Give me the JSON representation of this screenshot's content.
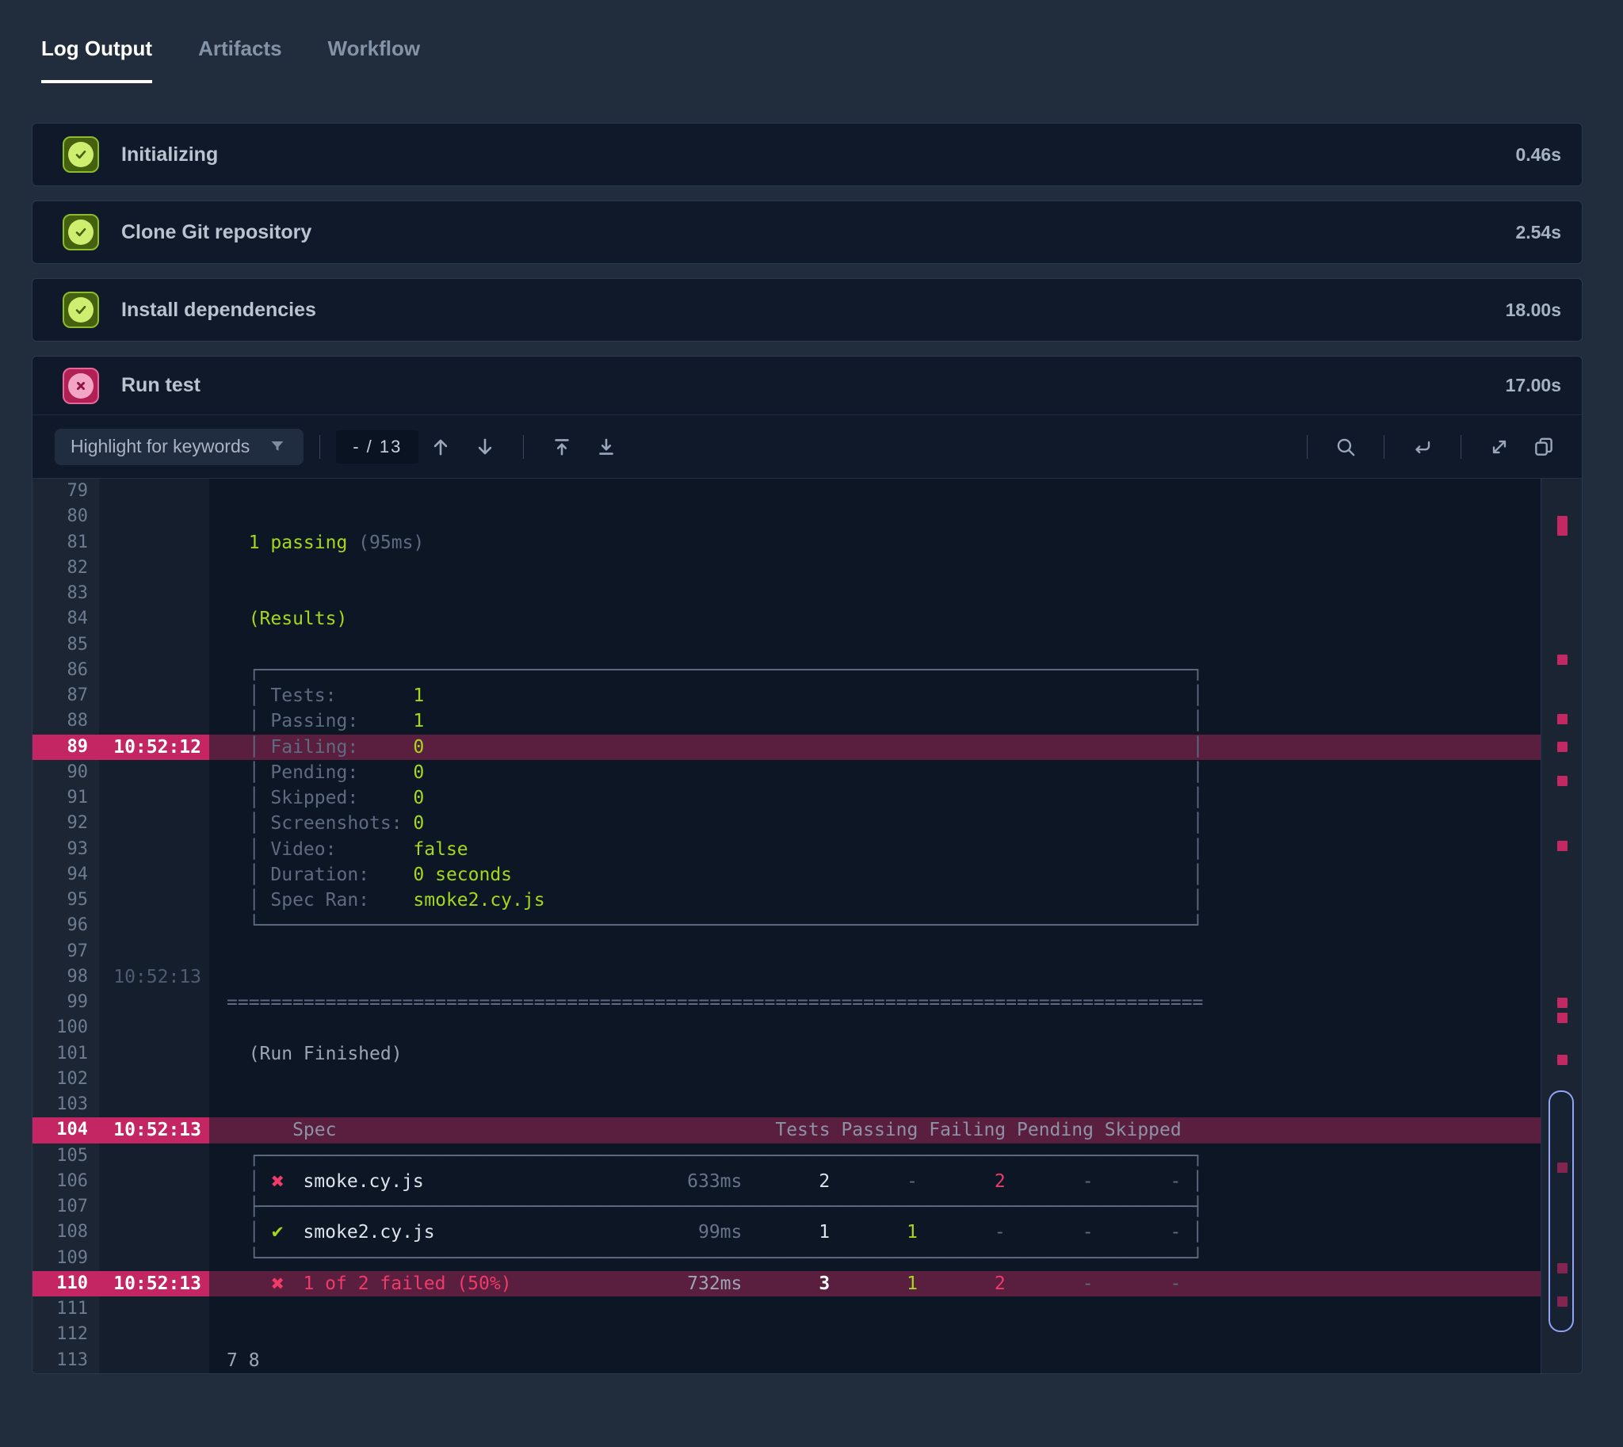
{
  "tabs": {
    "items": [
      {
        "label": "Log Output",
        "active": true
      },
      {
        "label": "Artifacts",
        "active": false
      },
      {
        "label": "Workflow",
        "active": false
      }
    ]
  },
  "steps": [
    {
      "label": "Initializing",
      "duration": "0.46s",
      "status": "success"
    },
    {
      "label": "Clone Git repository",
      "duration": "2.54s",
      "status": "success"
    },
    {
      "label": "Install dependencies",
      "duration": "18.00s",
      "status": "success"
    },
    {
      "label": "Run test",
      "duration": "17.00s",
      "status": "failed"
    }
  ],
  "toolbar": {
    "filter_label": "Highlight for keywords",
    "match_counter": "- / 13",
    "icons": [
      "filter",
      "previous-match",
      "next-match",
      "scroll-to-top",
      "scroll-to-bottom",
      "search",
      "wrap-lines",
      "expand",
      "copy"
    ]
  },
  "log": {
    "first_line": 79,
    "box_chars": {
      "h": "─",
      "v": "│",
      "tl": "┌",
      "tr": "┐",
      "bl": "└",
      "br": "┘",
      "ml": "├",
      "mr": "┤"
    },
    "marks": {
      "pass": "✔",
      "fail": "✖"
    },
    "hr": {
      "char": "=",
      "length": 89
    },
    "lines": [
      {
        "n": 79
      },
      {
        "n": 80
      },
      {
        "n": 81,
        "seg": [
          [
            "green",
            "  1 passing"
          ],
          [
            "gray",
            " (95ms)"
          ]
        ]
      },
      {
        "n": 82
      },
      {
        "n": 83
      },
      {
        "n": 84,
        "seg": [
          [
            "green",
            "  (Results)"
          ]
        ]
      },
      {
        "n": 85
      },
      {
        "n": 86,
        "box": "top"
      },
      {
        "n": 87,
        "box": "kv",
        "label": "Tests:",
        "value": "1"
      },
      {
        "n": 88,
        "box": "kv",
        "label": "Passing:",
        "value": "1"
      },
      {
        "n": 89,
        "hl": true,
        "ts": "10:52:12",
        "box": "kv",
        "label": "Failing:",
        "value": "0"
      },
      {
        "n": 90,
        "box": "kv",
        "label": "Pending:",
        "value": "0"
      },
      {
        "n": 91,
        "box": "kv",
        "label": "Skipped:",
        "value": "0"
      },
      {
        "n": 92,
        "box": "kv",
        "label": "Screenshots:",
        "value": "0"
      },
      {
        "n": 93,
        "box": "kv",
        "label": "Video:",
        "value": "false"
      },
      {
        "n": 94,
        "box": "kv",
        "label": "Duration:",
        "value": "0 seconds"
      },
      {
        "n": 95,
        "box": "kv",
        "label": "Spec Ran:",
        "value": "smoke2.cy.js"
      },
      {
        "n": 96,
        "box": "bottom"
      },
      {
        "n": 97
      },
      {
        "n": 98,
        "ts": "10:52:13"
      },
      {
        "n": 99,
        "rule": true
      },
      {
        "n": 100
      },
      {
        "n": 101,
        "seg": [
          [
            "light",
            "  (Run Finished)"
          ]
        ]
      },
      {
        "n": 102
      },
      {
        "n": 103
      },
      {
        "n": 104,
        "hl": true,
        "ts": "10:52:13",
        "thead": {
          "spec": "Spec",
          "cols": [
            "Tests",
            "Passing",
            "Failing",
            "Pending",
            "Skipped"
          ]
        }
      },
      {
        "n": 105,
        "box": "top"
      },
      {
        "n": 106,
        "box": "row",
        "mark": "fail",
        "spec": "smoke.cy.js",
        "dur": "633ms",
        "cells": [
          [
            "white",
            "2"
          ],
          [
            "gray",
            "-"
          ],
          [
            "red",
            "2"
          ],
          [
            "gray",
            "-"
          ],
          [
            "gray",
            "-"
          ]
        ]
      },
      {
        "n": 107,
        "box": "sep"
      },
      {
        "n": 108,
        "box": "row",
        "mark": "pass",
        "spec": "smoke2.cy.js",
        "dur": "99ms",
        "cells": [
          [
            "white",
            "1"
          ],
          [
            "green",
            "1"
          ],
          [
            "gray",
            "-"
          ],
          [
            "gray",
            "-"
          ],
          [
            "gray",
            "-"
          ]
        ]
      },
      {
        "n": 109,
        "box": "bottom"
      },
      {
        "n": 110,
        "hl": true,
        "ts": "10:52:13",
        "summary": {
          "mark": "fail",
          "text": "1 of 2 failed (50%)",
          "dur": "732ms",
          "cells": [
            [
              "wb",
              "3"
            ],
            [
              "green",
              "1"
            ],
            [
              "red",
              "2"
            ],
            [
              "gray",
              "-"
            ],
            [
              "gray",
              "-"
            ]
          ]
        }
      },
      {
        "n": 111
      },
      {
        "n": 112
      },
      {
        "n": 113,
        "seg": [
          [
            "light",
            "7 8"
          ]
        ]
      }
    ]
  },
  "minimap": {
    "markers_pct": [
      4.2,
      5.2,
      19.7,
      26.3,
      29.4,
      33.2,
      40.5,
      58.0,
      59.7,
      64.4,
      76.4,
      87.7,
      91.4
    ],
    "thumb": {
      "top_pct": 68.4,
      "height_pct": 27.0
    }
  },
  "colors": {
    "accent_pink": "#c32663",
    "row_highlight": "#5a1f3e",
    "success_green": "#a6d71c",
    "fail_red": "#ef3a6a",
    "thumb_border": "#93a2f5",
    "page_bg": "#212d3d",
    "panel_bg": "#0f1929"
  }
}
